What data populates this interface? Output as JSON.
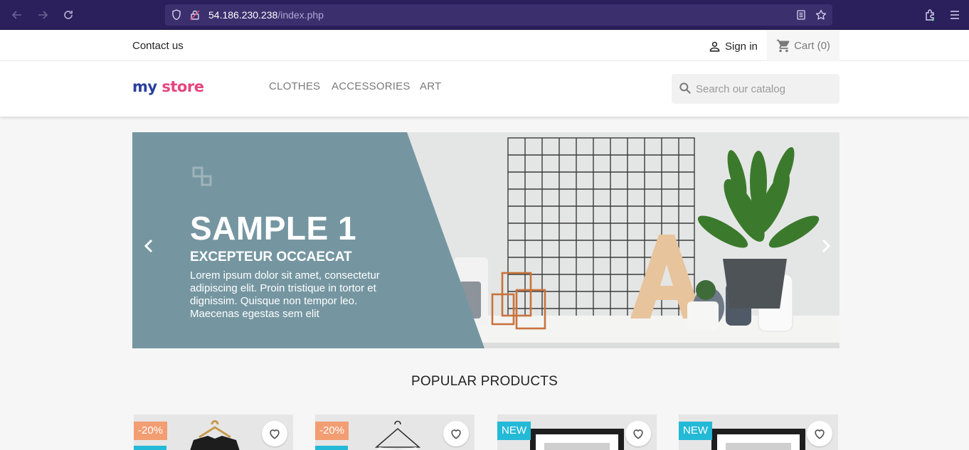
{
  "browser": {
    "url_host": "54.186.230.238",
    "url_path": "/index.php",
    "back_icon": "arrow-left-icon",
    "forward_icon": "arrow-right-icon",
    "reload_icon": "reload-icon"
  },
  "topnav": {
    "contact": "Contact us",
    "signin": "Sign in",
    "cart": "Cart (0)"
  },
  "header": {
    "logo_parts": [
      "my",
      "store"
    ],
    "menu": [
      "CLOTHES",
      "ACCESSORIES",
      "ART"
    ],
    "search_placeholder": "Search our catalog"
  },
  "carousel": {
    "title": "SAMPLE 1",
    "subtitle": "EXCEPTEUR OCCAECAT",
    "description": "Lorem ipsum dolor sit amet, consectetur adipiscing elit. Proin tristique in tortor et dignissim. Quisque non tempor leo. Maecenas egestas sem elit"
  },
  "products_section": {
    "title": "POPULAR PRODUCTS",
    "products": [
      {
        "badge": "-20%",
        "badge_type": "sale"
      },
      {
        "badge": "-20%",
        "badge_type": "sale"
      },
      {
        "badge": "NEW",
        "badge_type": "new"
      },
      {
        "badge": "NEW",
        "badge_type": "new"
      }
    ]
  },
  "colors": {
    "browser_bar": "#2b1f5c",
    "slide_panel": "#7596a1",
    "sale_badge": "#f39d72",
    "new_badge": "#24b9d7"
  }
}
